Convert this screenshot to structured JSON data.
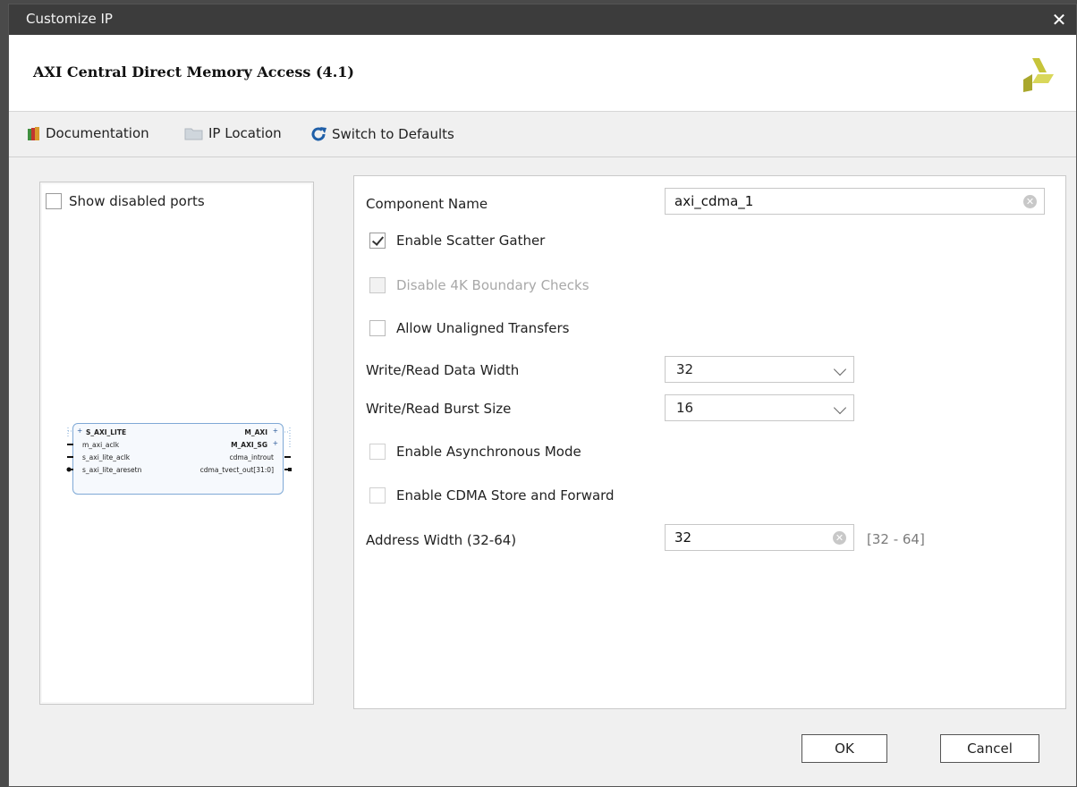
{
  "window": {
    "title": "Customize IP",
    "close_label": "✕"
  },
  "header": {
    "ip_title": "AXI Central Direct Memory Access (4.1)"
  },
  "toolbar": {
    "documentation": "Documentation",
    "ip_location": "IP Location",
    "switch_defaults": "Switch to Defaults"
  },
  "left_panel": {
    "show_disabled_ports_label": "Show disabled ports",
    "show_disabled_ports_checked": false,
    "symbol": {
      "left_ports": [
        "S_AXI_LITE",
        "m_axi_aclk",
        "s_axi_lite_aclk",
        "s_axi_lite_aresetn"
      ],
      "right_ports": [
        "M_AXI",
        "M_AXI_SG",
        "cdma_introut",
        "cdma_tvect_out[31:0]"
      ]
    }
  },
  "form": {
    "component_name_label": "Component Name",
    "component_name_value": "axi_cdma_1",
    "enable_scatter_gather": {
      "label": "Enable Scatter Gather",
      "checked": true,
      "enabled": true
    },
    "disable_4k": {
      "label": "Disable 4K Boundary Checks",
      "checked": false,
      "enabled": false
    },
    "allow_unaligned": {
      "label": "Allow Unaligned Transfers",
      "checked": false,
      "enabled": true
    },
    "data_width_label": "Write/Read Data Width",
    "data_width_value": "32",
    "burst_size_label": "Write/Read Burst Size",
    "burst_size_value": "16",
    "async_mode": {
      "label": "Enable Asynchronous Mode",
      "checked": false,
      "enabled": false
    },
    "store_forward": {
      "label": "Enable CDMA Store and Forward",
      "checked": false,
      "enabled": false
    },
    "address_width_label": "Address Width (32-64)",
    "address_width_value": "32",
    "address_width_range": "[32 - 64]"
  },
  "buttons": {
    "ok": "OK",
    "cancel": "Cancel"
  },
  "icons": {
    "documentation": "book-icon",
    "ip_location": "folder-icon",
    "switch_defaults": "refresh-icon",
    "logo": "xilinx-logo-icon",
    "clear": "clear-icon"
  },
  "colors": {
    "titlebar": "#3c3c3c",
    "refresh_blue": "#1f5fa8",
    "logo_yellow": "#c6c43a"
  }
}
